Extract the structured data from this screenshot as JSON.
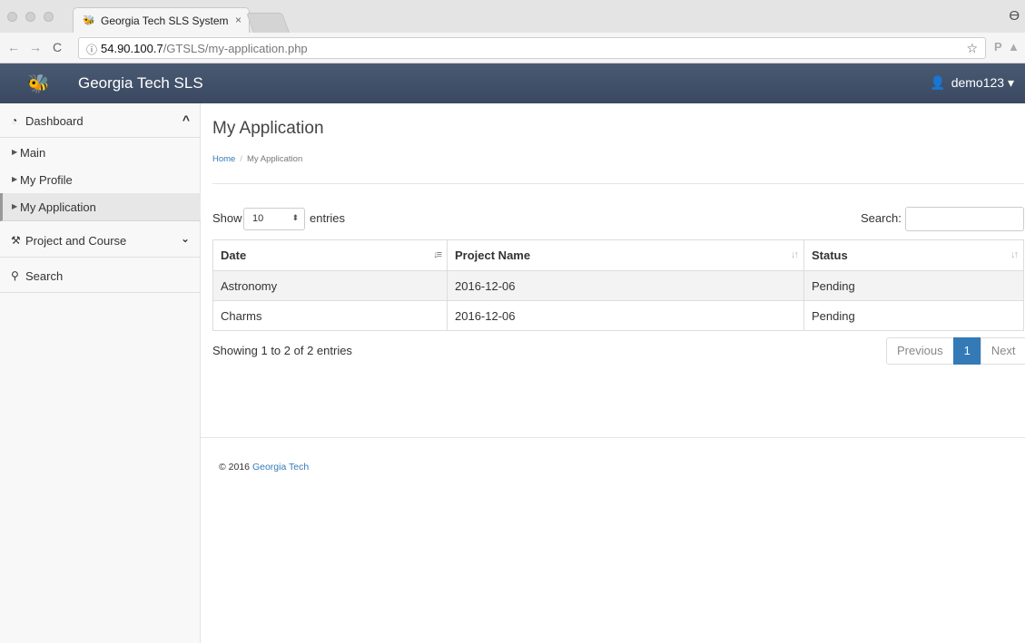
{
  "browser": {
    "tab_title": "Georgia Tech SLS System",
    "tab_close": "×",
    "url_host": "54.90.100.7",
    "url_path": "/GTSLS/my-application.php"
  },
  "header": {
    "brand": "Georgia Tech SLS",
    "user": "demo123"
  },
  "sidebar": {
    "dashboard": "Dashboard",
    "items": [
      {
        "label": "Main",
        "active": false
      },
      {
        "label": "My Profile",
        "active": false
      },
      {
        "label": "My Application",
        "active": true
      }
    ],
    "project_course": "Project and Course",
    "search": "Search"
  },
  "main": {
    "title": "My Application",
    "breadcrumb_home": "Home",
    "breadcrumb_sep": "/",
    "breadcrumb_current": "My Application",
    "show_label": "Show",
    "page_length": "10",
    "entries_label": "entries",
    "search_label": "Search:",
    "search_value": ""
  },
  "table": {
    "columns": [
      "Date",
      "Project Name",
      "Status"
    ],
    "rows": [
      [
        "Astronomy",
        "2016-12-06",
        "Pending"
      ],
      [
        "Charms",
        "2016-12-06",
        "Pending"
      ]
    ]
  },
  "footer_info": {
    "showing": "Showing 1 to 2 of 2 entries",
    "previous": "Previous",
    "current_page": "1",
    "next": "Next"
  },
  "footer": {
    "copyright": "© 2016",
    "link": "Georgia Tech"
  },
  "colors": {
    "header_bg": "#3f4e67",
    "link": "#337ab7",
    "active_page": "#337ab7"
  }
}
